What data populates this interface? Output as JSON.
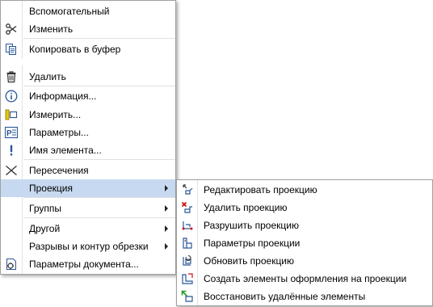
{
  "main_menu": {
    "items": [
      {
        "label": "Вспомогательный",
        "icon": "none"
      },
      {
        "label": "Изменить",
        "icon": "scissors-icon"
      },
      {
        "label": "Копировать в буфер",
        "icon": "copy-icon"
      },
      {
        "label": "Удалить",
        "icon": "trash-icon"
      },
      {
        "label": "Информация...",
        "icon": "info-icon"
      },
      {
        "label": "Измерить...",
        "icon": "measure-icon"
      },
      {
        "label": "Параметры...",
        "icon": "parameters-icon"
      },
      {
        "label": "Имя элемента...",
        "icon": "exclamation-icon"
      },
      {
        "label": "Пересечения",
        "icon": "intersection-icon"
      },
      {
        "label": "Проекция",
        "icon": "none",
        "submenu": true,
        "highlighted": true
      },
      {
        "label": "Группы",
        "icon": "none",
        "submenu": true
      },
      {
        "label": "Другой",
        "icon": "none",
        "submenu": true
      },
      {
        "label": "Разрывы и контур обрезки",
        "icon": "none",
        "submenu": true
      },
      {
        "label": "Параметры документа...",
        "icon": "document-settings-icon"
      }
    ]
  },
  "sub_menu": {
    "items": [
      {
        "label": "Редактировать проекцию",
        "icon": "edit-projection-icon"
      },
      {
        "label": "Удалить проекцию",
        "icon": "delete-projection-icon"
      },
      {
        "label": "Разрушить проекцию",
        "icon": "explode-projection-icon"
      },
      {
        "label": "Параметры проекции",
        "icon": "projection-parameters-icon"
      },
      {
        "label": "Обновить проекцию",
        "icon": "update-projection-icon"
      },
      {
        "label": "Создать элементы оформления на проекции",
        "icon": "create-annotation-icon"
      },
      {
        "label": "Восстановить удалённые элементы",
        "icon": "restore-elements-icon"
      }
    ]
  },
  "colors": {
    "highlight": "#c6d9f0",
    "icon_blue": "#2b5797",
    "icon_red": "#d01010",
    "icon_green": "#2a9a2a",
    "icon_yellow": "#e8c800"
  }
}
